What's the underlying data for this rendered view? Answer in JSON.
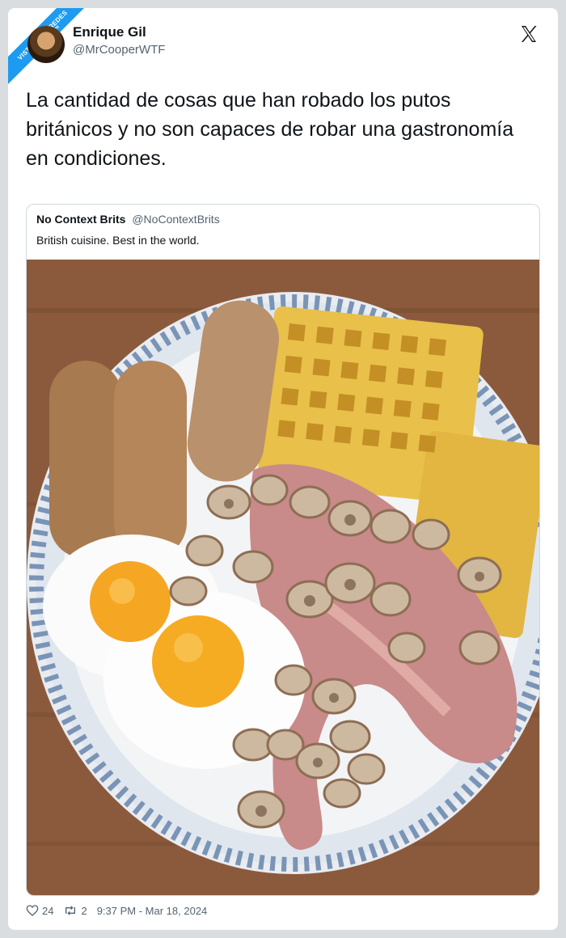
{
  "watermark": {
    "text": "VISTOENLASREDES",
    "sub": ".com"
  },
  "author": {
    "name": "Enrique Gil",
    "handle": "@MrCooperWTF"
  },
  "tweet": {
    "text": "La cantidad de cosas que han robado los putos británicos y no son capaces de robar una gastronomía en condiciones."
  },
  "quote": {
    "name": "No Context Brits",
    "handle": "@NoContextBrits",
    "text": "British cuisine. Best in the world."
  },
  "footer": {
    "likes": "24",
    "retweets": "2",
    "timestamp": "9:37 PM - Mar 18, 2024"
  },
  "icons": {
    "brand": "x-logo-icon",
    "like": "heart-icon",
    "retweet": "retweet-icon"
  },
  "colors": {
    "accent": "#1d9bf0",
    "text": "#0f1419",
    "muted": "#536471"
  }
}
